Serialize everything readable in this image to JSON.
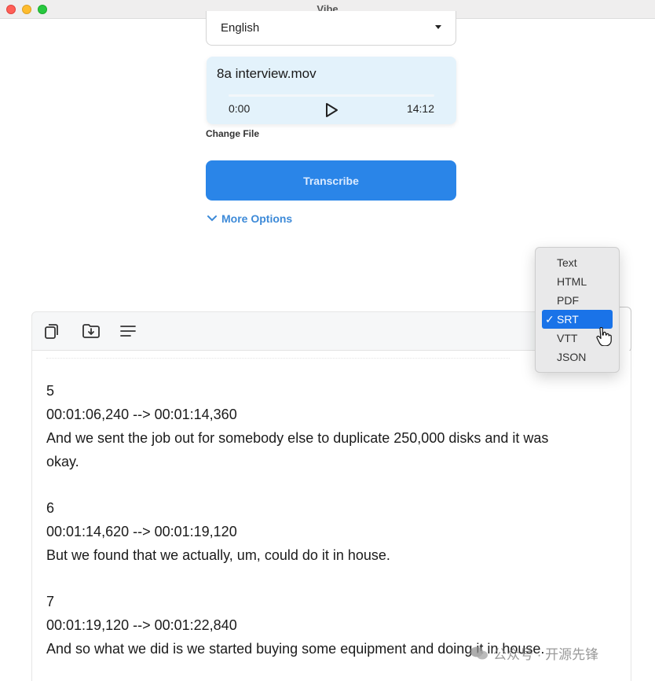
{
  "window": {
    "title": "Vibe"
  },
  "language": {
    "selected": "English"
  },
  "file": {
    "name": "8a interview.mov",
    "current_time": "0:00",
    "duration": "14:12",
    "progress": 0
  },
  "actions": {
    "change_file": "Change File",
    "transcribe": "Transcribe",
    "more_options": "More Options"
  },
  "format_menu": {
    "selected": "SRT",
    "items": [
      {
        "label": "Text",
        "check": ""
      },
      {
        "label": "HTML",
        "check": ""
      },
      {
        "label": "PDF",
        "check": ""
      },
      {
        "label": "SRT",
        "check": "✓"
      },
      {
        "label": "VTT",
        "check": ""
      },
      {
        "label": "JSON",
        "check": ""
      }
    ]
  },
  "transcript": {
    "cues": [
      {
        "index": "5",
        "timing": "00:01:06,240 --> 00:01:14,360",
        "text_line1": "And we sent the job out for somebody else to duplicate 250,000 disks and it was",
        "text_line2": "okay."
      },
      {
        "index": "6",
        "timing": "00:01:14,620 --> 00:01:19,120",
        "text_line1": "But we found that we actually, um, could do it in house."
      },
      {
        "index": "7",
        "timing": "00:01:19,120 --> 00:01:22,840",
        "text_line1": "And so what we did is we started buying some equipment and doing it in house."
      }
    ]
  },
  "watermark": {
    "text": "公众号 · 开源先锋"
  },
  "colors": {
    "accent": "#2a85e8",
    "link": "#3d8ad8",
    "card_bg": "#e3f2fb",
    "menu_selected": "#1a73e8"
  },
  "icons": [
    "copy-icon",
    "save-to-folder-icon",
    "menu-lines-icon",
    "play-icon",
    "chevron-down-icon",
    "hand-cursor-icon",
    "wechat-icon"
  ]
}
